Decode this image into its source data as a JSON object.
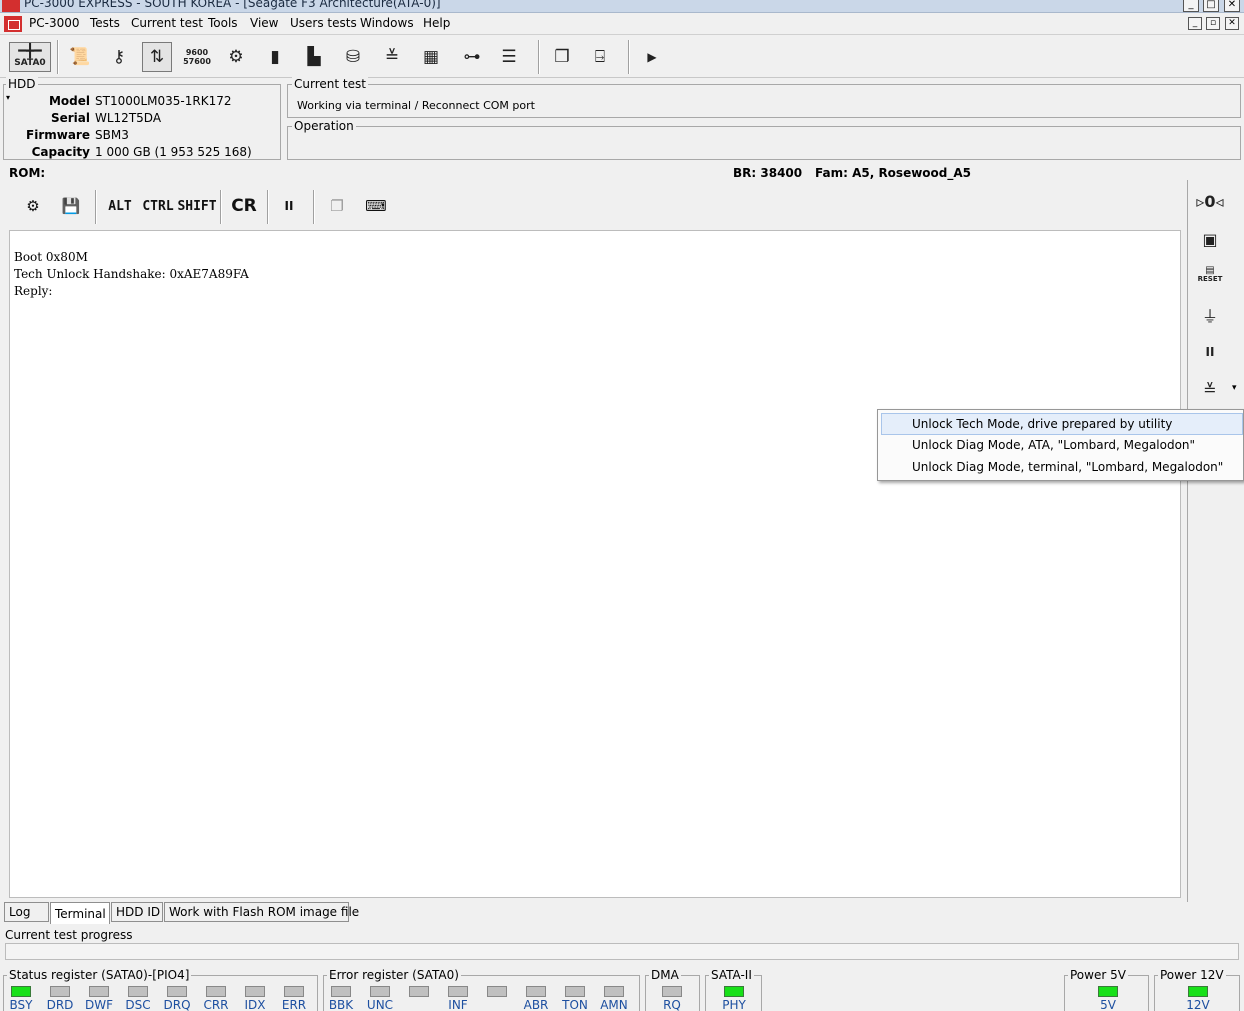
{
  "window": {
    "title": "PC-3000 EXPRESS - SOUTH KOREA - [Seagate F3 Architecture(ATA-0)]",
    "minimize": "_",
    "maximize": "□",
    "close": "✕",
    "mdi_minimize": "_",
    "mdi_restore": "▫",
    "mdi_close": "✕"
  },
  "menu": [
    "PC-3000",
    "Tests",
    "Current test",
    "Tools",
    "View",
    "Users tests",
    "Windows",
    "Help"
  ],
  "toolbar": {
    "sata_label": "SATA0",
    "baud_top": "9600",
    "baud_bottom": "57600"
  },
  "hdd": {
    "group_label": "HDD",
    "fields": [
      {
        "key": "Model",
        "value": "ST1000LM035-1RK172"
      },
      {
        "key": "Serial",
        "value": "WL12T5DA"
      },
      {
        "key": "Firmware",
        "value": "SBM3"
      },
      {
        "key": "Capacity",
        "value": "1 000 GB (1 953 525 168)"
      }
    ]
  },
  "current_test": {
    "label": "Current test",
    "value": "Working via terminal / Reconnect COM port"
  },
  "operation": {
    "label": "Operation"
  },
  "rom_line": {
    "rom": "ROM:",
    "br": "BR: 38400",
    "fam": "Fam: A5, Rosewood_A5"
  },
  "terminal_toolbar": {
    "alt": "ALT",
    "ctrl": "CTRL",
    "shift": "SHIFT",
    "cr": "CR",
    "pause": "II"
  },
  "terminal": {
    "lines": [
      "Boot 0x80M",
      "Tech Unlock Handshake: 0xAE7A89FA",
      "Reply:"
    ]
  },
  "right_toolbar": {
    "reset_label": "RESET",
    "pause": "II"
  },
  "context_menu": {
    "items": [
      "Unlock Tech Mode, drive prepared by utility",
      "Unlock Diag Mode, ATA, \"Lombard, Megalodon\"",
      "Unlock Diag Mode, terminal, \"Lombard, Megalodon\""
    ]
  },
  "tabs": [
    "Log",
    "Terminal",
    "HDD ID",
    "Work with Flash ROM image file"
  ],
  "progress": {
    "label": "Current test progress",
    "value": 0
  },
  "status_register": {
    "label": "Status register (SATA0)-[PIO4]",
    "leds": [
      {
        "name": "BSY",
        "on": true
      },
      {
        "name": "DRD",
        "on": false
      },
      {
        "name": "DWF",
        "on": false
      },
      {
        "name": "DSC",
        "on": false
      },
      {
        "name": "DRQ",
        "on": false
      },
      {
        "name": "CRR",
        "on": false
      },
      {
        "name": "IDX",
        "on": false
      },
      {
        "name": "ERR",
        "on": false
      }
    ]
  },
  "error_register": {
    "label": "Error register (SATA0)",
    "leds": [
      {
        "name": "BBK",
        "on": false
      },
      {
        "name": "UNC",
        "on": false
      },
      {
        "name": "",
        "on": false
      },
      {
        "name": "INF",
        "on": false
      },
      {
        "name": "",
        "on": false
      },
      {
        "name": "ABR",
        "on": false
      },
      {
        "name": "TON",
        "on": false
      },
      {
        "name": "AMN",
        "on": false
      }
    ]
  },
  "dma": {
    "label": "DMA",
    "led": "RQ",
    "on": false
  },
  "sata2": {
    "label": "SATA-II",
    "led": "PHY",
    "on": true
  },
  "power5": {
    "label": "Power 5V",
    "led": "5V",
    "on": true
  },
  "power12": {
    "label": "Power 12V",
    "led": "12V",
    "on": true
  },
  "colors": {
    "led_on": "#18e018",
    "led_off": "#c0c0c0",
    "led_label": "#1d4fa0",
    "menu_highlight": "#e5eefa"
  }
}
